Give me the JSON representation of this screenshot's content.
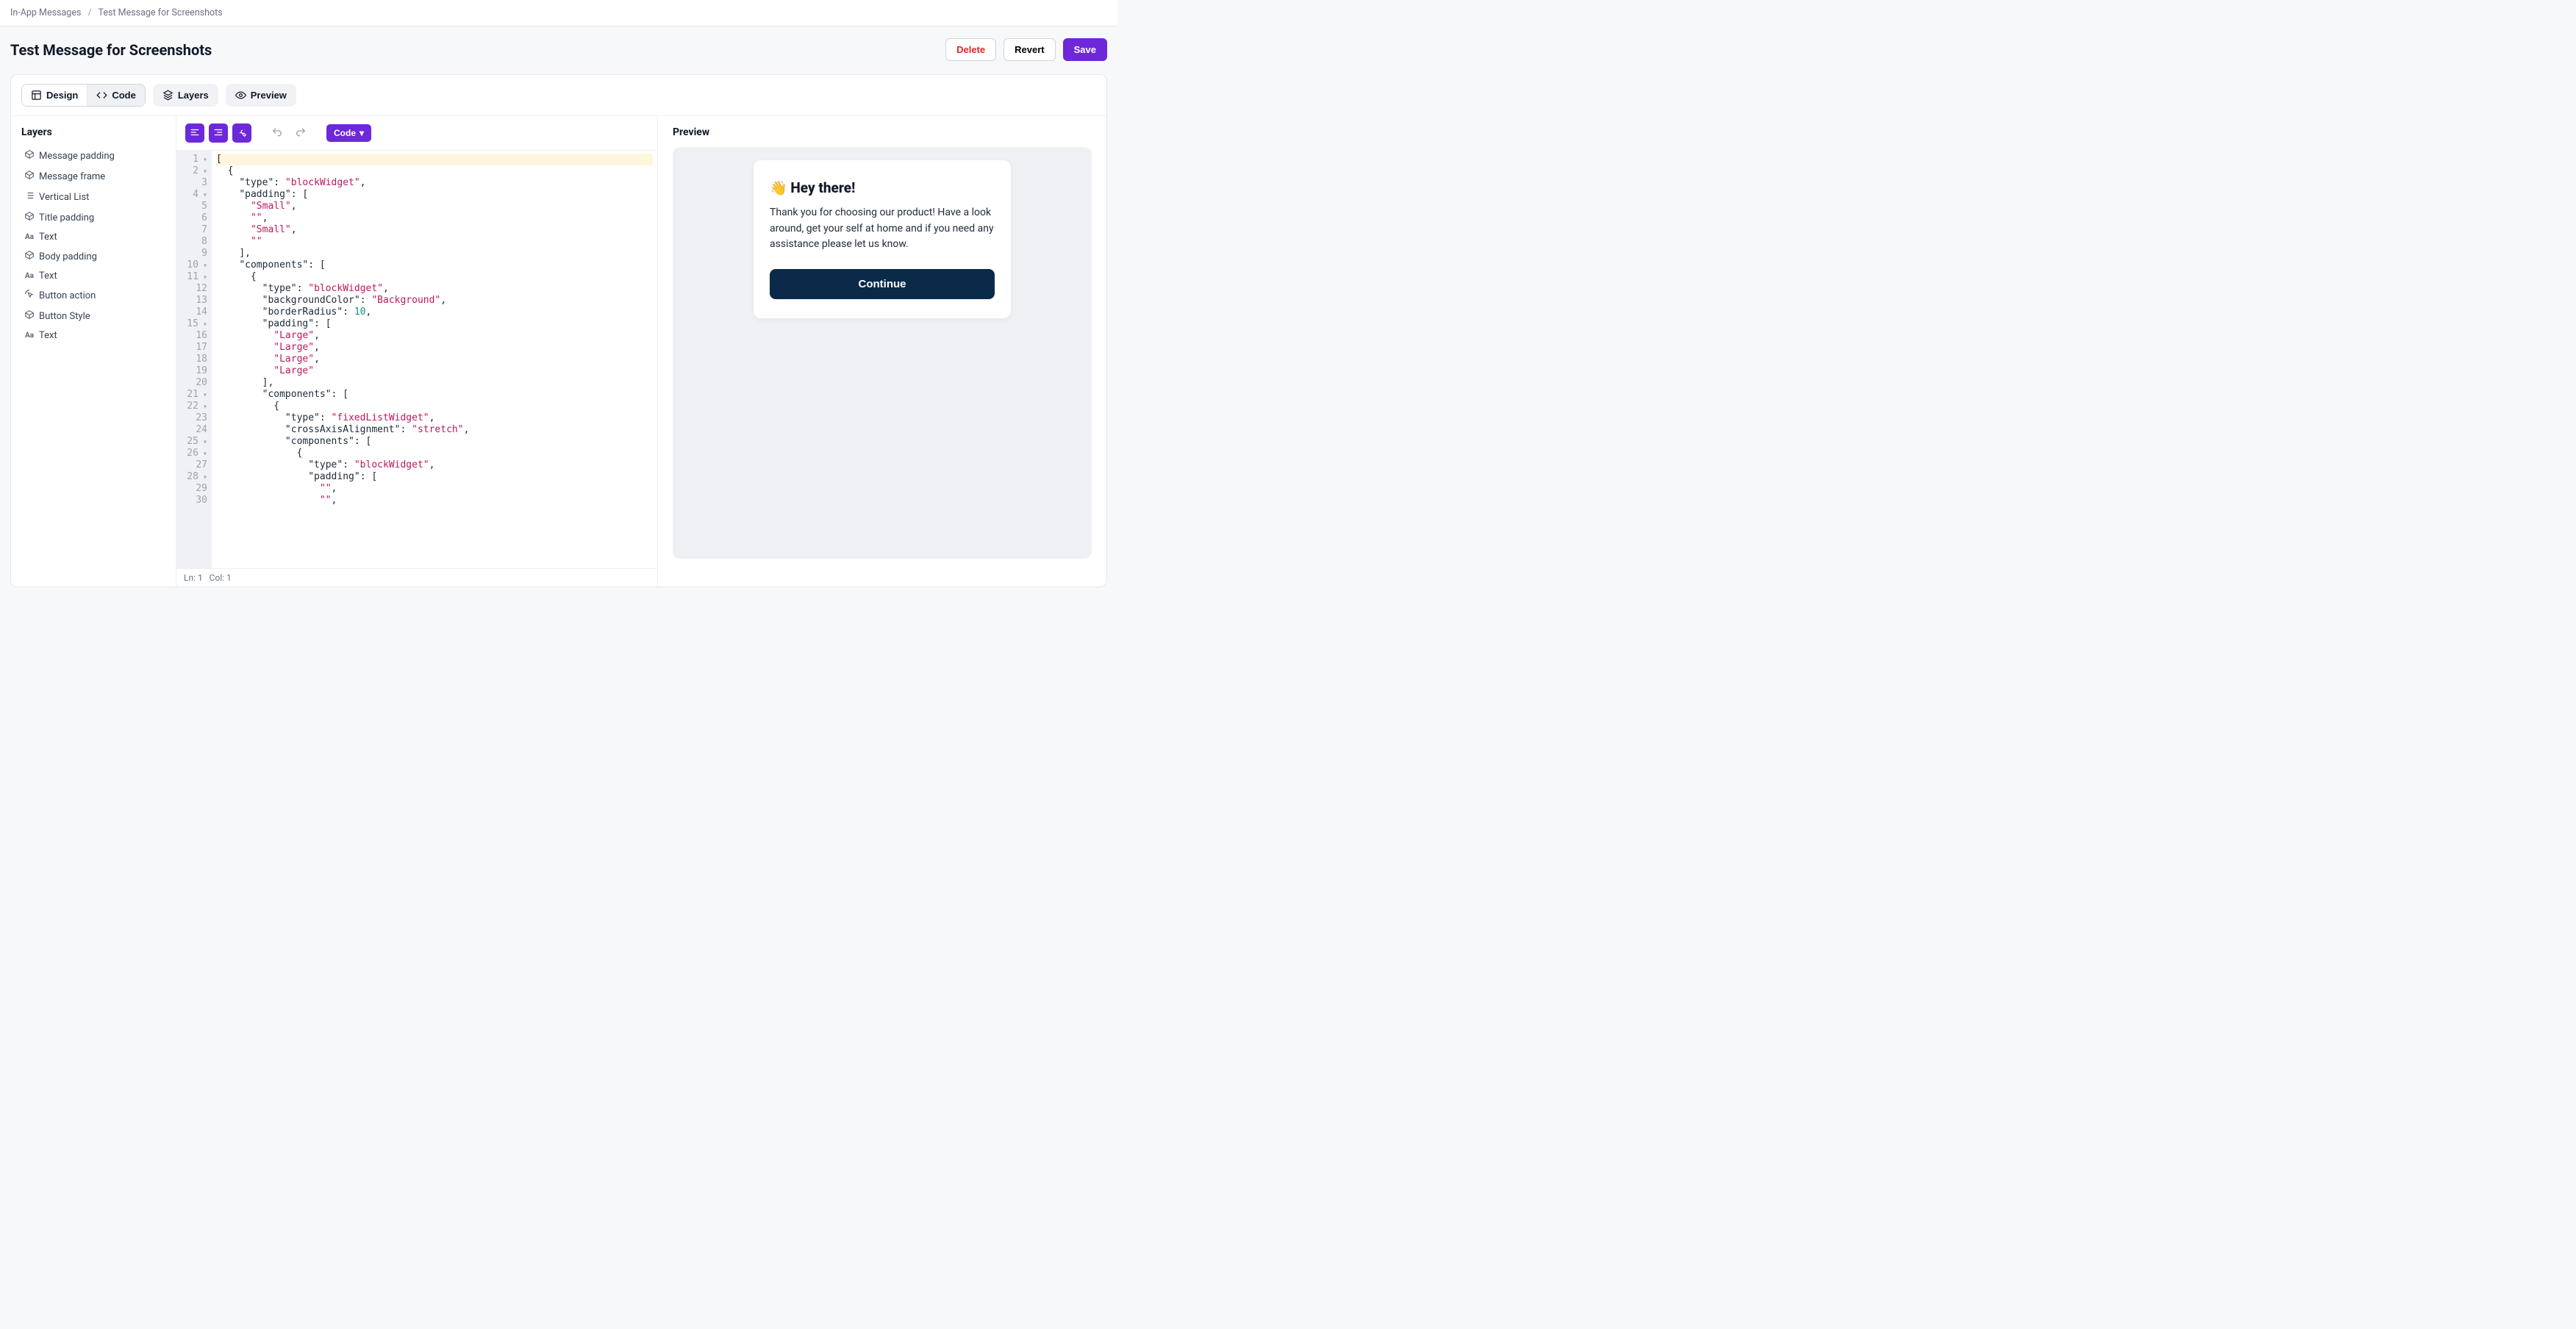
{
  "breadcrumb": {
    "root": "In-App Messages",
    "current": "Test Message for Screenshots"
  },
  "title": "Test Message for Screenshots",
  "actions": {
    "delete": "Delete",
    "revert": "Revert",
    "save": "Save"
  },
  "toolbar": {
    "design": "Design",
    "code": "Code",
    "layers": "Layers",
    "preview": "Preview"
  },
  "layers": {
    "heading": "Layers",
    "items": [
      {
        "indent": 1,
        "icon": "box",
        "label": "Message padding"
      },
      {
        "indent": 2,
        "icon": "box",
        "label": "Message frame"
      },
      {
        "indent": 2,
        "icon": "list",
        "label": "Vertical List"
      },
      {
        "indent": 3,
        "icon": "box",
        "label": "Title padding"
      },
      {
        "indent": 4,
        "icon": "aa",
        "label": "Text"
      },
      {
        "indent": 3,
        "icon": "box",
        "label": "Body padding"
      },
      {
        "indent": 4,
        "icon": "aa",
        "label": "Text"
      },
      {
        "indent": 3,
        "icon": "click",
        "label": "Button action"
      },
      {
        "indent": 4,
        "icon": "box",
        "label": "Button Style"
      },
      {
        "indent": 5,
        "icon": "aa",
        "label": "Text"
      }
    ]
  },
  "codeToolbar": {
    "dropdown": "Code"
  },
  "editor": {
    "status": {
      "ln": 1,
      "col": 1
    },
    "lines": [
      {
        "n": 1,
        "fold": true,
        "tokens": [
          [
            "punc",
            "["
          ]
        ]
      },
      {
        "n": 2,
        "fold": true,
        "tokens": [
          [
            "sp",
            "  "
          ],
          [
            "punc",
            "{"
          ]
        ]
      },
      {
        "n": 3,
        "fold": false,
        "tokens": [
          [
            "sp",
            "    "
          ],
          [
            "key",
            "\"type\""
          ],
          [
            "punc",
            ": "
          ],
          [
            "str",
            "\"blockWidget\""
          ],
          [
            "punc",
            ","
          ]
        ]
      },
      {
        "n": 4,
        "fold": true,
        "tokens": [
          [
            "sp",
            "    "
          ],
          [
            "key",
            "\"padding\""
          ],
          [
            "punc",
            ": ["
          ]
        ]
      },
      {
        "n": 5,
        "fold": false,
        "tokens": [
          [
            "sp",
            "      "
          ],
          [
            "str",
            "\"Small\""
          ],
          [
            "punc",
            ","
          ]
        ]
      },
      {
        "n": 6,
        "fold": false,
        "tokens": [
          [
            "sp",
            "      "
          ],
          [
            "str",
            "\"\""
          ],
          [
            "punc",
            ","
          ]
        ]
      },
      {
        "n": 7,
        "fold": false,
        "tokens": [
          [
            "sp",
            "      "
          ],
          [
            "str",
            "\"Small\""
          ],
          [
            "punc",
            ","
          ]
        ]
      },
      {
        "n": 8,
        "fold": false,
        "tokens": [
          [
            "sp",
            "      "
          ],
          [
            "str",
            "\"\""
          ]
        ]
      },
      {
        "n": 9,
        "fold": false,
        "tokens": [
          [
            "sp",
            "    "
          ],
          [
            "punc",
            "],"
          ]
        ]
      },
      {
        "n": 10,
        "fold": true,
        "tokens": [
          [
            "sp",
            "    "
          ],
          [
            "key",
            "\"components\""
          ],
          [
            "punc",
            ": ["
          ]
        ]
      },
      {
        "n": 11,
        "fold": true,
        "tokens": [
          [
            "sp",
            "      "
          ],
          [
            "punc",
            "{"
          ]
        ]
      },
      {
        "n": 12,
        "fold": false,
        "tokens": [
          [
            "sp",
            "        "
          ],
          [
            "key",
            "\"type\""
          ],
          [
            "punc",
            ": "
          ],
          [
            "str",
            "\"blockWidget\""
          ],
          [
            "punc",
            ","
          ]
        ]
      },
      {
        "n": 13,
        "fold": false,
        "tokens": [
          [
            "sp",
            "        "
          ],
          [
            "key",
            "\"backgroundColor\""
          ],
          [
            "punc",
            ": "
          ],
          [
            "str",
            "\"Background\""
          ],
          [
            "punc",
            ","
          ]
        ]
      },
      {
        "n": 14,
        "fold": false,
        "tokens": [
          [
            "sp",
            "        "
          ],
          [
            "key",
            "\"borderRadius\""
          ],
          [
            "punc",
            ": "
          ],
          [
            "num",
            "10"
          ],
          [
            "punc",
            ","
          ]
        ]
      },
      {
        "n": 15,
        "fold": true,
        "tokens": [
          [
            "sp",
            "        "
          ],
          [
            "key",
            "\"padding\""
          ],
          [
            "punc",
            ": ["
          ]
        ]
      },
      {
        "n": 16,
        "fold": false,
        "tokens": [
          [
            "sp",
            "          "
          ],
          [
            "str",
            "\"Large\""
          ],
          [
            "punc",
            ","
          ]
        ]
      },
      {
        "n": 17,
        "fold": false,
        "tokens": [
          [
            "sp",
            "          "
          ],
          [
            "str",
            "\"Large\""
          ],
          [
            "punc",
            ","
          ]
        ]
      },
      {
        "n": 18,
        "fold": false,
        "tokens": [
          [
            "sp",
            "          "
          ],
          [
            "str",
            "\"Large\""
          ],
          [
            "punc",
            ","
          ]
        ]
      },
      {
        "n": 19,
        "fold": false,
        "tokens": [
          [
            "sp",
            "          "
          ],
          [
            "str",
            "\"Large\""
          ]
        ]
      },
      {
        "n": 20,
        "fold": false,
        "tokens": [
          [
            "sp",
            "        "
          ],
          [
            "punc",
            "],"
          ]
        ]
      },
      {
        "n": 21,
        "fold": true,
        "tokens": [
          [
            "sp",
            "        "
          ],
          [
            "key",
            "\"components\""
          ],
          [
            "punc",
            ": ["
          ]
        ]
      },
      {
        "n": 22,
        "fold": true,
        "tokens": [
          [
            "sp",
            "          "
          ],
          [
            "punc",
            "{"
          ]
        ]
      },
      {
        "n": 23,
        "fold": false,
        "tokens": [
          [
            "sp",
            "            "
          ],
          [
            "key",
            "\"type\""
          ],
          [
            "punc",
            ": "
          ],
          [
            "str",
            "\"fixedListWidget\""
          ],
          [
            "punc",
            ","
          ]
        ]
      },
      {
        "n": 24,
        "fold": false,
        "tokens": [
          [
            "sp",
            "            "
          ],
          [
            "key",
            "\"crossAxisAlignment\""
          ],
          [
            "punc",
            ": "
          ],
          [
            "str",
            "\"stretch\""
          ],
          [
            "punc",
            ","
          ]
        ]
      },
      {
        "n": 25,
        "fold": true,
        "tokens": [
          [
            "sp",
            "            "
          ],
          [
            "key",
            "\"components\""
          ],
          [
            "punc",
            ": ["
          ]
        ]
      },
      {
        "n": 26,
        "fold": true,
        "tokens": [
          [
            "sp",
            "              "
          ],
          [
            "punc",
            "{"
          ]
        ]
      },
      {
        "n": 27,
        "fold": false,
        "tokens": [
          [
            "sp",
            "                "
          ],
          [
            "key",
            "\"type\""
          ],
          [
            "punc",
            ": "
          ],
          [
            "str",
            "\"blockWidget\""
          ],
          [
            "punc",
            ","
          ]
        ]
      },
      {
        "n": 28,
        "fold": true,
        "tokens": [
          [
            "sp",
            "                "
          ],
          [
            "key",
            "\"padding\""
          ],
          [
            "punc",
            ": ["
          ]
        ]
      },
      {
        "n": 29,
        "fold": false,
        "tokens": [
          [
            "sp",
            "                  "
          ],
          [
            "str",
            "\"\""
          ],
          [
            "punc",
            ","
          ]
        ]
      },
      {
        "n": 30,
        "fold": false,
        "tokens": [
          [
            "sp",
            "                  "
          ],
          [
            "str",
            "\"\""
          ],
          [
            "punc",
            ","
          ]
        ]
      }
    ]
  },
  "preview": {
    "heading": "Preview",
    "card": {
      "title": "👋 Hey there!",
      "body": "Thank you for choosing our product! Have a look around, get your self at home and if you need any assistance please let us know.",
      "cta": "Continue"
    }
  }
}
